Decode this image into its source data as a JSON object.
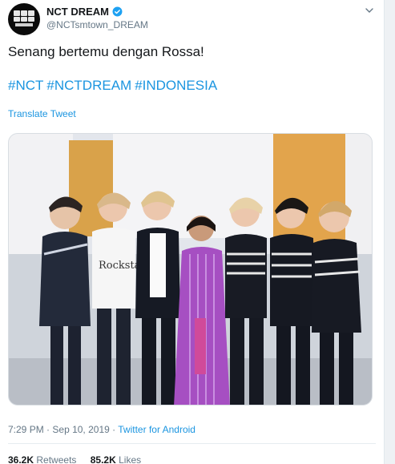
{
  "user": {
    "display_name": "NCT DREAM",
    "handle": "@NCTsmtown_DREAM"
  },
  "tweet": {
    "text": "Senang bertemu dengan Rossa!",
    "hashtags": [
      "#NCT",
      "#NCTDREAM",
      "#INDONESIA"
    ],
    "translate_label": "Translate Tweet"
  },
  "meta": {
    "time": "7:29 PM",
    "date": "Sep 10, 2019",
    "source": "Twitter for Android"
  },
  "stats": {
    "retweets_count": "36.2K",
    "retweets_label": "Retweets",
    "likes_count": "85.2K",
    "likes_label": "Likes"
  },
  "colors": {
    "link": "#1b95e0",
    "verified": "#1da1f2",
    "secondary_text": "#657786"
  },
  "photo_content": {
    "shirt_text": "Rockstar"
  }
}
